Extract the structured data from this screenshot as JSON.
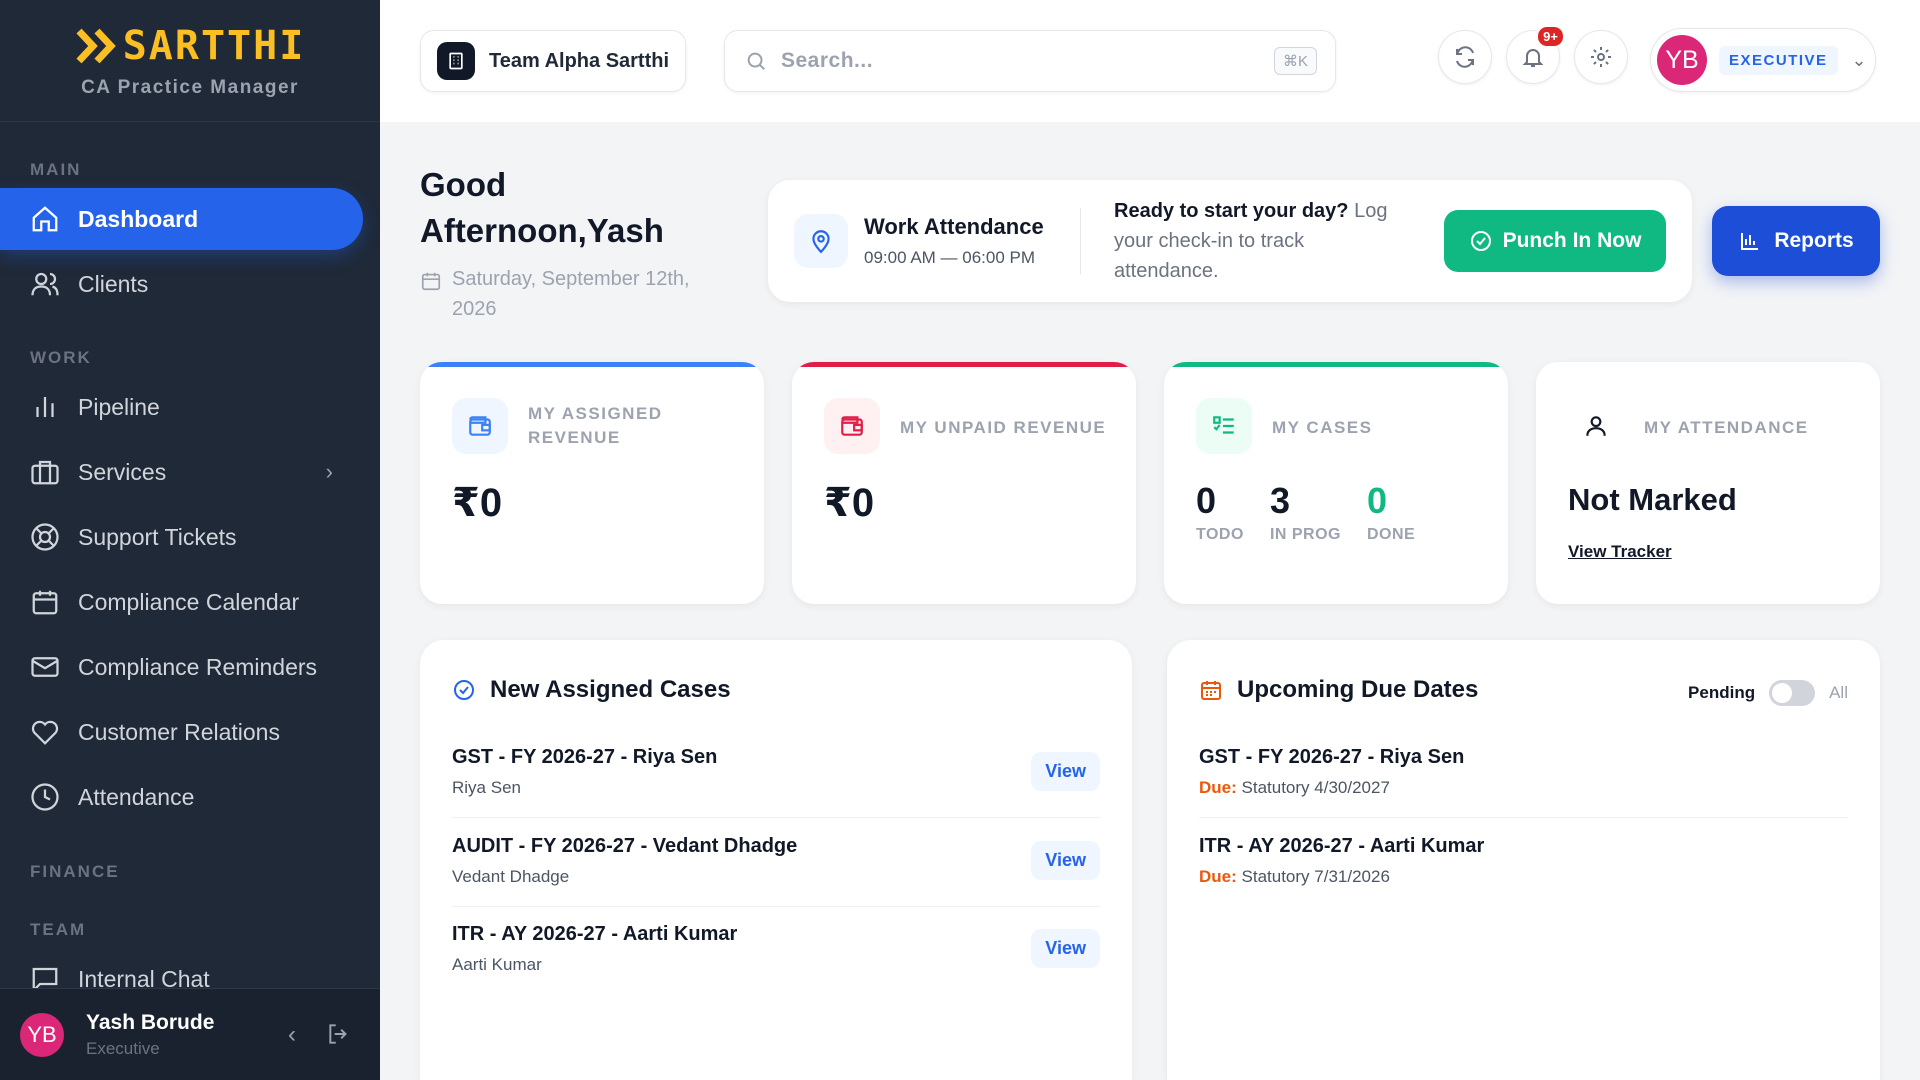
{
  "brand": {
    "name": "SARTTHI",
    "subtitle": "CA Practice Manager"
  },
  "sidebar": {
    "sections": {
      "main": "MAIN",
      "work": "WORK",
      "finance": "FINANCE",
      "team": "TEAM"
    },
    "items": [
      {
        "label": "Dashboard",
        "icon": "home-icon",
        "active": true
      },
      {
        "label": "Clients",
        "icon": "users-icon"
      },
      {
        "label": "Pipeline",
        "icon": "bar-chart-icon"
      },
      {
        "label": "Services",
        "icon": "briefcase-icon",
        "has_children": true
      },
      {
        "label": "Support Tickets",
        "icon": "lifebuoy-icon"
      },
      {
        "label": "Compliance Calendar",
        "icon": "calendar-icon"
      },
      {
        "label": "Compliance Reminders",
        "icon": "mail-icon"
      },
      {
        "label": "Customer Relations",
        "icon": "heart-icon"
      },
      {
        "label": "Attendance",
        "icon": "clock-icon"
      },
      {
        "label": "Internal Chat",
        "icon": "chat-icon"
      }
    ],
    "user": {
      "initials": "YB",
      "name": "Yash Borude",
      "role": "Executive"
    }
  },
  "header": {
    "team": "Team Alpha Sartthi",
    "search_placeholder": "Search...",
    "search_shortcut": "⌘K",
    "notification_count": "9+",
    "user_initials": "YB",
    "user_role": "EXECUTIVE"
  },
  "greeting": {
    "line1": "Good",
    "line2": "Afternoon,Yash",
    "date": "Saturday, September 12th, 2026"
  },
  "attendance": {
    "title": "Work Attendance",
    "hours": "09:00 AM — 06:00 PM",
    "message_bold": "Ready to start your day?",
    "message_rest": " Log your check-in to track attendance.",
    "punch_label": "Punch In Now"
  },
  "reports_label": "Reports",
  "stats": {
    "assigned_revenue": {
      "label": "MY ASSIGNED REVENUE",
      "value": "₹0"
    },
    "unpaid_revenue": {
      "label": "MY UNPAID REVENUE",
      "value": "₹0"
    },
    "cases": {
      "label": "MY CASES",
      "todo": "0",
      "todo_label": "TODO",
      "in_prog": "3",
      "in_prog_label": "IN PROG",
      "done": "0",
      "done_label": "DONE"
    },
    "attendance": {
      "label": "MY ATTENDANCE",
      "value": "Not Marked",
      "link": "View Tracker"
    }
  },
  "new_cases": {
    "title": "New Assigned Cases",
    "view_label": "View",
    "rows": [
      {
        "title": "GST - FY 2026-27 - Riya Sen",
        "client": "Riya Sen"
      },
      {
        "title": "AUDIT - FY 2026-27 - Vedant Dhadge",
        "client": "Vedant Dhadge"
      },
      {
        "title": "ITR - AY 2026-27 - Aarti Kumar",
        "client": "Aarti Kumar"
      }
    ]
  },
  "due_dates": {
    "title": "Upcoming Due Dates",
    "toggle_on_label": "Pending",
    "toggle_off_label": "All",
    "due_prefix": "Due:",
    "rows": [
      {
        "title": "GST - FY 2026-27 - Riya Sen",
        "due": "Statutory 4/30/2027"
      },
      {
        "title": "ITR - AY 2026-27 - Aarti Kumar",
        "due": "Statutory 7/31/2026"
      }
    ]
  },
  "colors": {
    "sidebar_bg": "#1f2937",
    "active": "#2563eb",
    "brand": "#fbbf24",
    "success": "#10b981",
    "danger": "#e11d48"
  }
}
